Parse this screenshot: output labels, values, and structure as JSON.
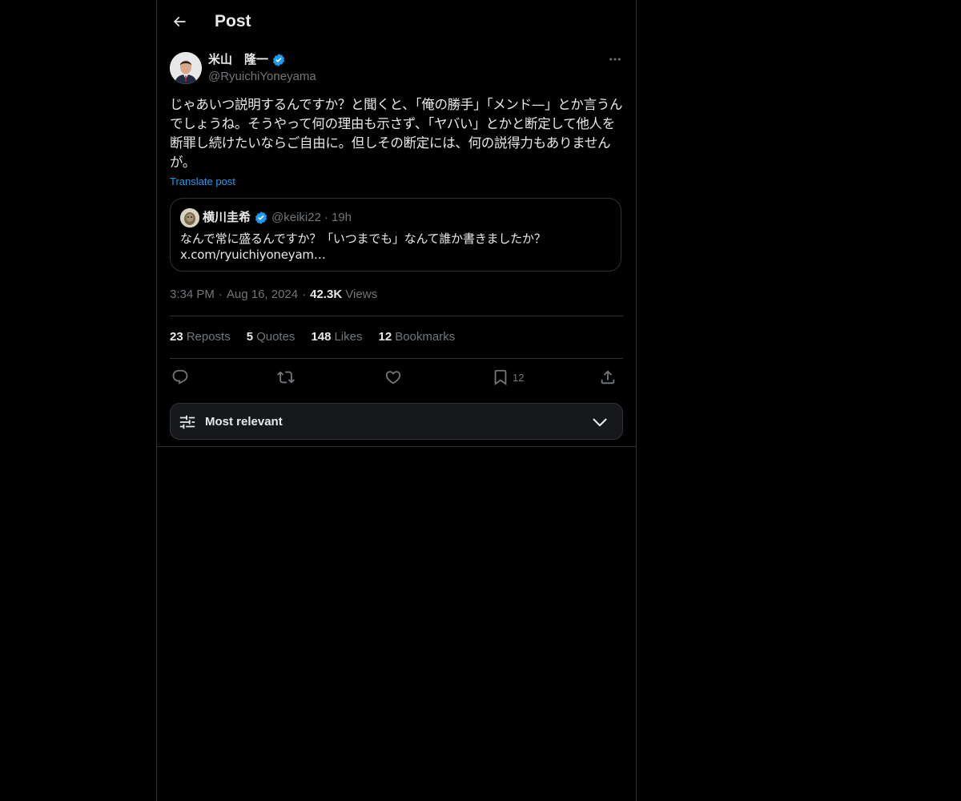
{
  "header": {
    "title": "Post",
    "back_icon": "arrow-left-icon"
  },
  "post": {
    "author_name": "米山　隆一",
    "author_handle": "@RyuichiYoneyama",
    "verified": true,
    "text": "じゃあいつ説明するんですか？と聞くと、「俺の勝手」「メンド—」とか言うんでしょうね。そうやって何の理由も示さず、「ヤバい」とかと断定して他人を断罪し続けたいならご自由に。但しその断定には、何の説得力もありませんが。",
    "translate_label": "Translate post",
    "quote": {
      "author_name": "横川圭希",
      "author_handle": "@keiki22",
      "separator": "·",
      "time": "19h",
      "text": "なんで常に盛るんですか？「いつまでも」なんて誰か書きましたか？",
      "link": "x.com/ryuichiyoneyam…"
    },
    "time": "3:34 PM",
    "separator": "·",
    "date": "Aug 16, 2024",
    "views_count": "42.3K",
    "views_label": "Views"
  },
  "stats": {
    "reposts_count": "23",
    "reposts_label": "Reposts",
    "quotes_count": "5",
    "quotes_label": "Quotes",
    "likes_count": "148",
    "likes_label": "Likes",
    "bookmarks_count": "12",
    "bookmarks_label": "Bookmarks"
  },
  "actions": {
    "reply_icon": "reply-icon",
    "repost_icon": "repost-icon",
    "like_icon": "heart-icon",
    "bookmark_icon": "bookmark-icon",
    "bookmark_count": "12",
    "share_icon": "share-icon"
  },
  "sort": {
    "label": "Most relevant",
    "icon": "sliders-icon",
    "chevron": "chevron-down-icon"
  },
  "colors": {
    "background": "#000000",
    "text": "#e7e9ea",
    "secondary": "#71767b",
    "accent": "#1d9bf0",
    "border": "#2f3336"
  }
}
